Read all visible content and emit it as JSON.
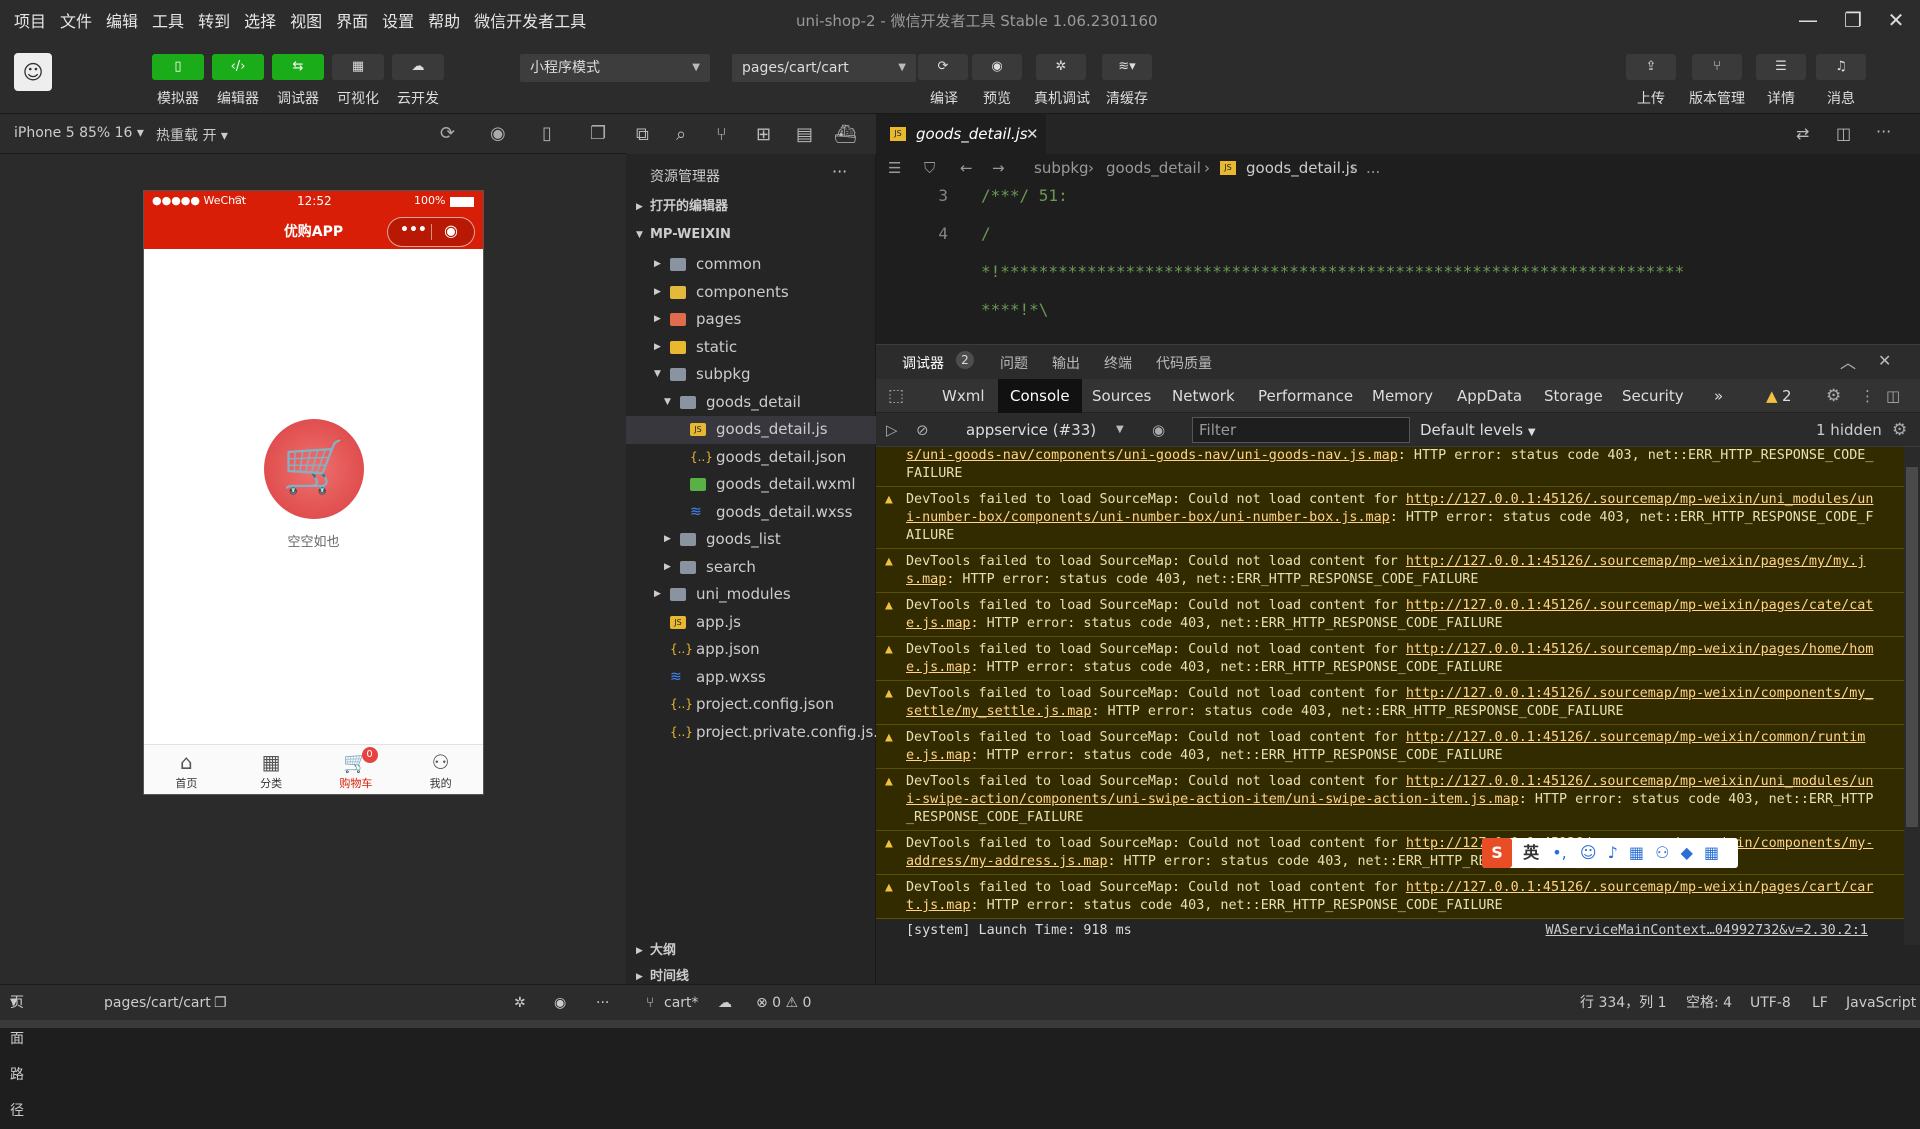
{
  "menu": [
    "项目",
    "文件",
    "编辑",
    "工具",
    "转到",
    "选择",
    "视图",
    "界面",
    "设置",
    "帮助",
    "微信开发者工具"
  ],
  "window_title": "uni-shop-2 - 微信开发者工具 Stable 1.06.2301160",
  "toolbar": {
    "left_buttons": [
      "模拟器",
      "编辑器",
      "调试器",
      "可视化",
      "云开发"
    ],
    "mode": "小程序模式",
    "page_path": "pages/cart/cart",
    "mid_buttons": [
      "编译",
      "预览",
      "真机调试",
      "清缓存"
    ],
    "right_buttons": [
      "上传",
      "版本管理",
      "详情",
      "消息"
    ]
  },
  "sim": {
    "device": "iPhone 5 85% 16",
    "hotreload": "热重载 开",
    "status_left": "●●●●● WeChat",
    "time": "12:52",
    "battery": "100%",
    "nav_title": "优购APP",
    "empty_text": "空空如也",
    "tabs": [
      "首页",
      "分类",
      "购物车",
      "我的"
    ],
    "cart_badge": "0"
  },
  "explorer": {
    "title": "资源管理器",
    "open_editors": "打开的编辑器",
    "project": "MP-WEIXIN",
    "tree": [
      "common",
      "components",
      "pages",
      "static",
      "subpkg",
      "goods_detail",
      "goods_detail.js",
      "goods_detail.json",
      "goods_detail.wxml",
      "goods_detail.wxss",
      "goods_list",
      "search",
      "uni_modules",
      "app.js",
      "app.json",
      "app.wxss",
      "project.config.json",
      "project.private.config.js..."
    ],
    "outline": "大纲",
    "timeline": "时间线"
  },
  "editor": {
    "tab": "goods_detail.js",
    "crumbs": [
      "subpkg",
      "goods_detail",
      "goods_detail.js",
      "..."
    ],
    "lines": [
      {
        "n": "3",
        "t": "/***/ 51:"
      },
      {
        "n": "4",
        "t": "/"
      },
      {
        "n": "",
        "t": "*!***********************************************************************"
      },
      {
        "n": "",
        "t": "****!*\\"
      }
    ]
  },
  "panel": {
    "tabs": [
      "调试器",
      "问题",
      "输出",
      "终端",
      "代码质量"
    ],
    "debugger_count": "2",
    "devtabs": [
      "Wxml",
      "Console",
      "Sources",
      "Network",
      "Performance",
      "Memory",
      "AppData",
      "Storage",
      "Security",
      "»"
    ],
    "warn_count": "2",
    "context": "appservice (#33)",
    "filter_placeholder": "Filter",
    "levels": "Default levels",
    "hidden": "1 hidden",
    "first_line_a": "s/uni-goods-nav/components/uni-goods-nav/uni-goods-nav.js.map",
    "first_line_b": ": HTTP error: status code 403, net::ERR_HTTP_RESPONSE_CODE_FAILURE",
    "messages": [
      {
        "a": "DevTools failed to load SourceMap: Could not load content for ",
        "u": "http://127.0.0.1:45126/.sourcemap/mp-weixin/uni_modules/uni-number-box/components/uni-number-box/uni-number-box.js.map",
        "b": ": HTTP error: status code 403, net::ERR_HTTP_RESPONSE_CODE_FAILURE"
      },
      {
        "a": "DevTools failed to load SourceMap: Could not load content for ",
        "u": "http://127.0.0.1:45126/.sourcemap/mp-weixin/pages/my/my.js.map",
        "b": ": HTTP error: status code 403, net::ERR_HTTP_RESPONSE_CODE_FAILURE"
      },
      {
        "a": "DevTools failed to load SourceMap: Could not load content for ",
        "u": "http://127.0.0.1:45126/.sourcemap/mp-weixin/pages/cate/cate.js.map",
        "b": ": HTTP error: status code 403, net::ERR_HTTP_RESPONSE_CODE_FAILURE"
      },
      {
        "a": "DevTools failed to load SourceMap: Could not load content for ",
        "u": "http://127.0.0.1:45126/.sourcemap/mp-weixin/pages/home/home.js.map",
        "b": ": HTTP error: status code 403, net::ERR_HTTP_RESPONSE_CODE_FAILURE"
      },
      {
        "a": "DevTools failed to load SourceMap: Could not load content for ",
        "u": "http://127.0.0.1:45126/.sourcemap/mp-weixin/components/my_settle/my_settle.js.map",
        "b": ": HTTP error: status code 403, net::ERR_HTTP_RESPONSE_CODE_FAILURE"
      },
      {
        "a": "DevTools failed to load SourceMap: Could not load content for ",
        "u": "http://127.0.0.1:45126/.sourcemap/mp-weixin/common/runtime.js.map",
        "b": ": HTTP error: status code 403, net::ERR_HTTP_RESPONSE_CODE_FAILURE"
      },
      {
        "a": "DevTools failed to load SourceMap: Could not load content for ",
        "u": "http://127.0.0.1:45126/.sourcemap/mp-weixin/uni_modules/uni-swipe-action/components/uni-swipe-action-item/uni-swipe-action-item.js.map",
        "b": ": HTTP error: status code 403, net::ERR_HTTP_RESPONSE_CODE_FAILURE"
      },
      {
        "a": "DevTools failed to load SourceMap: Could not load content for ",
        "u": "http://127.0.0.1:45126/.sourcemap/mp-weixin/components/my-address/my-address.js.map",
        "b": ": HTTP error: status code 403, net::ERR_HTTP_RESPONSE_CODE_FAILURE"
      },
      {
        "a": "DevTools failed to load SourceMap: Could not load content for ",
        "u": "http://127.0.0.1:45126/.sourcemap/mp-weixin/pages/cart/cart.js.map",
        "b": ": HTTP error: status code 403, net::ERR_HTTP_RESPONSE_CODE_FAILURE"
      }
    ],
    "system": "[system] Launch Time: 918 ms",
    "system_src": "WAServiceMainContext…04992732&v=2.30.2:1"
  },
  "ime": "英",
  "statusbar": {
    "page_path_label": "页面路径",
    "page_path": "pages/cart/cart",
    "branch": "cart*",
    "problems": "⊗ 0 ⚠ 0",
    "position": "行 334，列 1",
    "indent": "空格: 4",
    "encoding": "UTF-8",
    "eol": "LF",
    "language": "JavaScript"
  }
}
